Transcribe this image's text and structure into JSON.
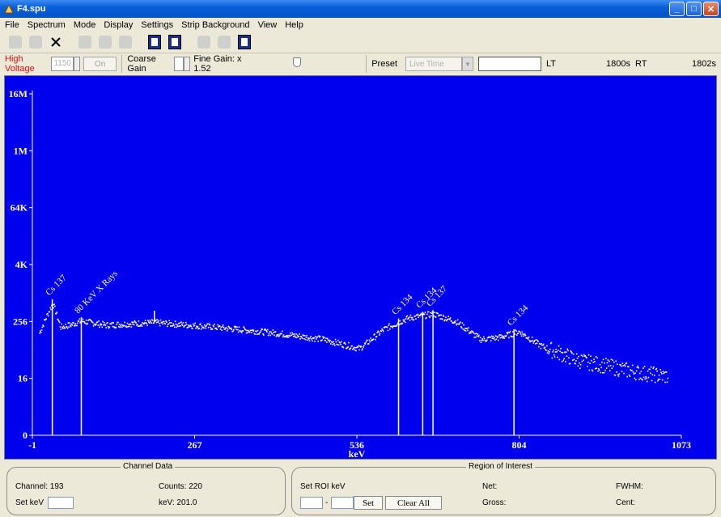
{
  "window": {
    "title": "F4.spu",
    "minimize": "_",
    "maximize": "□",
    "close": "✕"
  },
  "menu": [
    "File",
    "Spectrum",
    "Mode",
    "Display",
    "Settings",
    "Strip Background",
    "View",
    "Help"
  ],
  "controls": {
    "high_voltage_label": "High Voltage",
    "high_voltage_value": "1150",
    "on_button": "On",
    "coarse_gain_label": "Coarse Gain",
    "fine_gain_label": "Fine Gain: x 1.52",
    "fine_gain_value": 1.52,
    "preset_label": "Preset",
    "preset_select": "Live Time",
    "lt_label": "LT",
    "lt_value": "1800s",
    "rt_label": "RT",
    "rt_value": "1802s"
  },
  "chart_data": {
    "type": "scatter",
    "xlabel": "keV",
    "x_ticks": [
      "-1",
      "267",
      "536",
      "804",
      "1073"
    ],
    "y_ticks": [
      "0",
      "16",
      "256",
      "4K",
      "64K",
      "1M",
      "16M"
    ],
    "xlim": [
      -1,
      1073
    ],
    "y_scale": "log (base 2, 4 powers per major tick)",
    "background": "#0000ee",
    "point_color": "#ffffff",
    "annotations": [
      {
        "label": "Cs 137",
        "x": 32
      },
      {
        "label": "80 KeV X Rays",
        "x": 80
      },
      {
        "label": "Cs 134",
        "x": 605
      },
      {
        "label": "Cs 134",
        "x": 645
      },
      {
        "label": "Cs 137",
        "x": 662
      },
      {
        "label": "Cs 134",
        "x": 796
      }
    ],
    "marker_x": 201,
    "curve": [
      {
        "x": 10,
        "y": 150
      },
      {
        "x": 20,
        "y": 300
      },
      {
        "x": 32,
        "y": 650
      },
      {
        "x": 45,
        "y": 200
      },
      {
        "x": 60,
        "y": 220
      },
      {
        "x": 80,
        "y": 270
      },
      {
        "x": 120,
        "y": 220
      },
      {
        "x": 200,
        "y": 250
      },
      {
        "x": 300,
        "y": 200
      },
      {
        "x": 400,
        "y": 150
      },
      {
        "x": 480,
        "y": 110
      },
      {
        "x": 540,
        "y": 70
      },
      {
        "x": 580,
        "y": 180
      },
      {
        "x": 620,
        "y": 310
      },
      {
        "x": 662,
        "y": 380
      },
      {
        "x": 700,
        "y": 260
      },
      {
        "x": 740,
        "y": 110
      },
      {
        "x": 770,
        "y": 120
      },
      {
        "x": 804,
        "y": 160
      },
      {
        "x": 840,
        "y": 80
      },
      {
        "x": 900,
        "y": 40
      },
      {
        "x": 1000,
        "y": 22
      },
      {
        "x": 1050,
        "y": 18
      }
    ]
  },
  "channel_data": {
    "title": "Channel Data",
    "channel": "Channel: 193",
    "counts": "Counts: 220",
    "set_kev_label": "Set keV",
    "kev": "keV: 201.0"
  },
  "roi": {
    "title": "Region of Interest",
    "set_roi_label": "Set ROI keV",
    "dash": "-",
    "set_button": "Set",
    "clear_button": "Clear All",
    "net": "Net:",
    "gross": "Gross:",
    "fwhm": "FWHM:",
    "cent": "Cent:"
  }
}
